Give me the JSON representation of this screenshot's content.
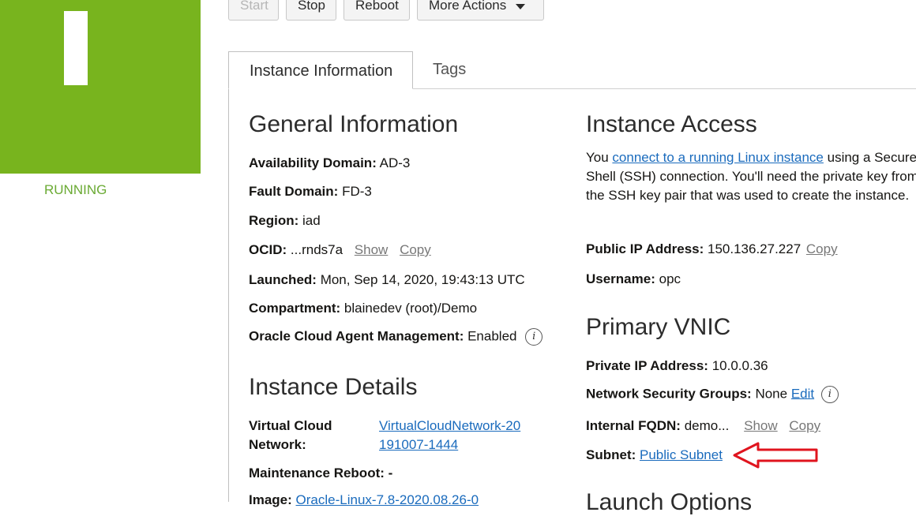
{
  "status": {
    "label": "RUNNING",
    "tile_color": "#78b41e"
  },
  "actions": {
    "start": "Start",
    "stop": "Stop",
    "reboot": "Reboot",
    "more": "More Actions"
  },
  "tabs": {
    "active": "Instance Information",
    "other": "Tags"
  },
  "general": {
    "heading": "General Information",
    "availability_domain": {
      "label": "Availability Domain:",
      "value": "AD-3"
    },
    "fault_domain": {
      "label": "Fault Domain:",
      "value": "FD-3"
    },
    "region": {
      "label": "Region:",
      "value": "iad"
    },
    "ocid": {
      "label": "OCID:",
      "value": "...rnds7a",
      "show": "Show",
      "copy": "Copy"
    },
    "launched": {
      "label": "Launched:",
      "value": "Mon, Sep 14, 2020, 19:43:13 UTC"
    },
    "compartment": {
      "label": "Compartment:",
      "value": "blainedev (root)/Demo"
    },
    "agent": {
      "label": "Oracle Cloud Agent Management:",
      "value": "Enabled"
    }
  },
  "details": {
    "heading": "Instance Details",
    "vcn": {
      "label": "Virtual Cloud Network:",
      "value": "VirtualCloudNetwork-20191007-1444"
    },
    "maintenance": {
      "label": "Maintenance Reboot:",
      "value": "-"
    },
    "image": {
      "label": "Image:",
      "value": "Oracle-Linux-7.8-2020.08.26-0"
    }
  },
  "access": {
    "heading": "Instance Access",
    "intro_before": "You ",
    "intro_link": "connect to a running Linux instance",
    "intro_after": " using a Secure Shell (SSH) connection. You'll need the private key from the SSH key pair that was used to create the instance.",
    "public_ip": {
      "label": "Public IP Address:",
      "value": "150.136.27.227",
      "copy": "Copy"
    },
    "username": {
      "label": "Username:",
      "value": "opc"
    }
  },
  "vnic": {
    "heading": "Primary VNIC",
    "private_ip": {
      "label": "Private IP Address:",
      "value": "10.0.0.36"
    },
    "nsg": {
      "label": "Network Security Groups:",
      "value": "None",
      "edit": "Edit"
    },
    "fqdn": {
      "label": "Internal FQDN:",
      "value": "demo...",
      "show": "Show",
      "copy": "Copy"
    },
    "subnet": {
      "label": "Subnet:",
      "value": "Public Subnet"
    }
  },
  "launch_options": {
    "heading": "Launch Options"
  },
  "annotation": {
    "arrow_color": "#e0141e"
  }
}
